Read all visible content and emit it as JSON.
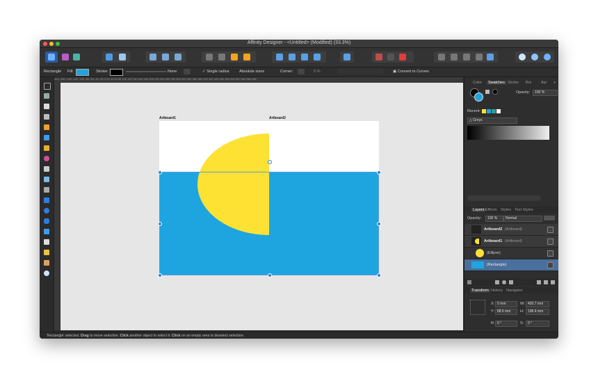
{
  "window": {
    "title": "Affinity Designer - <Untitled> (Modified) (33.3%)"
  },
  "context": {
    "selection": "Rectangle",
    "fill_label": "Fill:",
    "fill_color": "#1ea5e0",
    "stroke_label": "Stroke:",
    "stroke_value": "None",
    "single_radius": "Single radius",
    "absolute_sizes": "Absolute sizes",
    "corner_label": "Corner:",
    "corner_value": "0 %",
    "convert_label": "Convert to Curves"
  },
  "ruler": {
    "ticks": "mm  -160 -140 -120 -100 -80 -60 -40 -20 0 20 40 60 80 100 120 140 160 180 200 220 240 260 280 300 320 340 360 380 400 420 440 460 480 500 520 540 560 580"
  },
  "canvas": {
    "artboard1": "Artboard1",
    "artboard2": "Artboard2",
    "ellipse_color": "#fde233",
    "rect_color": "#1ea5e0"
  },
  "panel": {
    "top_tabs": [
      "Color",
      "Swatches",
      "Stroke",
      "Brs",
      "Apr"
    ],
    "opacity_label": "Opacity:",
    "opacity_value": "100 %",
    "recent_label": "Recent:",
    "palette": "Greys",
    "layers_tabs": [
      "Layers",
      "Effects",
      "Styles",
      "Text Styles"
    ],
    "layers_opacity_label": "Opacity:",
    "layers_opacity_value": "100 %",
    "blend_mode": "Normal",
    "layers": [
      {
        "name": "Artboard2",
        "type": "(Artboard)"
      },
      {
        "name": "Artboard1",
        "type": "(Artboard)"
      },
      {
        "name": "",
        "type": "(Ellipse)"
      },
      {
        "name": "",
        "type": "(Rectangle)"
      }
    ],
    "transform_tabs": [
      "Transform",
      "History",
      "Navigator"
    ],
    "x": "0 mm",
    "y": "88.6 mm",
    "w": "420.7 mm",
    "h": "198.4 mm",
    "r": "0 °",
    "s": "0 °",
    "x_label": "X:",
    "y_label": "Y:",
    "w_label": "W:",
    "h_label": "H:",
    "r_label": "R:",
    "s_label": "S:"
  },
  "status": {
    "prefix": "'Rectangle' selected.",
    "drag": "Drag",
    "drag_text": "to move selection.",
    "click": "Click",
    "click_text": "another object to select it.",
    "click2": "Click",
    "click2_text": "on an empty area to deselect selection."
  }
}
